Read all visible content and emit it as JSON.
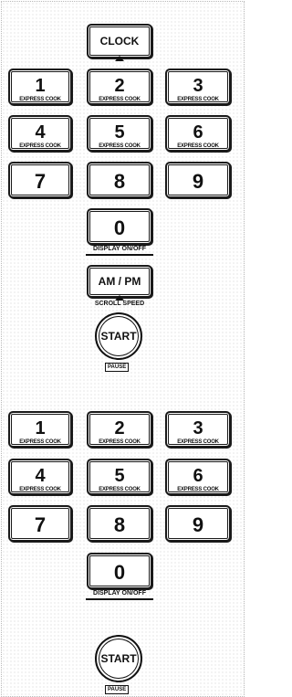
{
  "clock": {
    "label": "CLOCK"
  },
  "sections": [
    {
      "keys": [
        {
          "num": "1",
          "sub": "EXPRESS COOK"
        },
        {
          "num": "2",
          "sub": "EXPRESS COOK"
        },
        {
          "num": "3",
          "sub": "EXPRESS COOK"
        },
        {
          "num": "4",
          "sub": "EXPRESS COOK"
        },
        {
          "num": "5",
          "sub": "EXPRESS COOK"
        },
        {
          "num": "6",
          "sub": "EXPRESS COOK"
        },
        {
          "num": "7"
        },
        {
          "num": "8"
        },
        {
          "num": "9"
        },
        {
          "num": "0"
        }
      ],
      "zero_caption": "DISPLAY ON/OFF",
      "ampm": {
        "label": "AM / PM",
        "caption": "SCROLL SPEED"
      },
      "start": {
        "label": "START",
        "caption": "PAUSE"
      }
    },
    {
      "keys": [
        {
          "num": "1",
          "sub": "EXPRESS COOK"
        },
        {
          "num": "2",
          "sub": "EXPRESS COOK"
        },
        {
          "num": "3",
          "sub": "EXPRESS COOK"
        },
        {
          "num": "4",
          "sub": "EXPRESS COOK"
        },
        {
          "num": "5",
          "sub": "EXPRESS COOK"
        },
        {
          "num": "6",
          "sub": "EXPRESS COOK"
        },
        {
          "num": "7"
        },
        {
          "num": "8"
        },
        {
          "num": "9"
        },
        {
          "num": "0"
        }
      ],
      "zero_caption": "DISPLAY ON/OFF",
      "start": {
        "label": "START",
        "caption": "PAUSE"
      }
    }
  ],
  "icons": {
    "indicator": "triangle-up-icon"
  }
}
